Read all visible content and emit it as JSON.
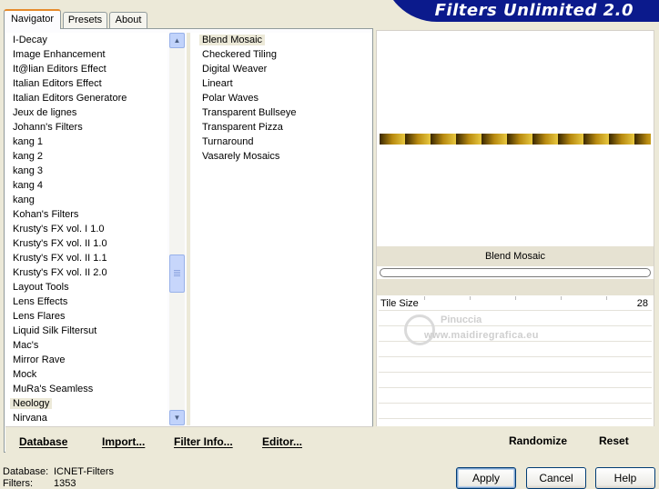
{
  "header": {
    "title": "Filters Unlimited 2.0"
  },
  "tabs": [
    {
      "label": "Navigator"
    },
    {
      "label": "Presets"
    },
    {
      "label": "About"
    }
  ],
  "categories": [
    "I-Decay",
    "Image Enhancement",
    "It@lian Editors Effect",
    "Italian Editors Effect",
    "Italian Editors Generatore",
    "Jeux de lignes",
    "Johann's Filters",
    "kang 1",
    "kang 2",
    "kang 3",
    "kang 4",
    "kang",
    "Kohan's Filters",
    "Krusty's FX vol. I 1.0",
    "Krusty's FX vol. II 1.0",
    "Krusty's FX vol. II 1.1",
    "Krusty's FX vol. II 2.0",
    "Layout Tools",
    "Lens Effects",
    "Lens Flares",
    "Liquid Silk Filtersut",
    "Mac's",
    "Mirror Rave",
    "Mock",
    "MuRa's Seamless",
    "Neology",
    "Nirvana"
  ],
  "selected_category": "Neology",
  "filters": [
    "Blend Mosaic",
    "Checkered Tiling",
    "Digital Weaver",
    "Lineart",
    "Polar Waves",
    "Transparent Bullseye",
    "Transparent Pizza",
    "Turnaround",
    "Vasarely Mosaics"
  ],
  "selected_filter": "Blend Mosaic",
  "bottom_actions": {
    "database": "Database",
    "import": "Import...",
    "filter_info": "Filter Info...",
    "editor": "Editor...",
    "randomize": "Randomize",
    "reset": "Reset"
  },
  "preview": {
    "filter_name": "Blend Mosaic"
  },
  "parameters": [
    {
      "label": "Tile Size",
      "value": "28"
    }
  ],
  "watermark": {
    "name": "Pinuccia",
    "url": "www.maidiregrafica.eu"
  },
  "footer": {
    "database_label": "Database:",
    "database_value": "ICNET-Filters",
    "filters_label": "Filters:",
    "filters_value": "1353"
  },
  "buttons": {
    "apply": "Apply",
    "cancel": "Cancel",
    "help": "Help"
  },
  "colors": {
    "header_bg": "#0b1a8c",
    "tab_accent": "#e68b2c",
    "scroll_thumb": "#c7d6fb"
  }
}
